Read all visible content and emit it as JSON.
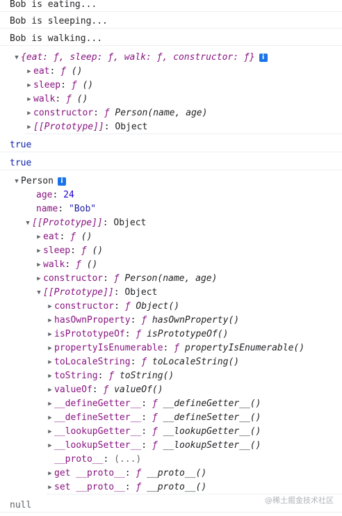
{
  "console": {
    "log1": "Bob is eating...",
    "log2": "Bob is sleeping...",
    "log3": "Bob is walking...",
    "proto_summary": "{eat: ƒ, sleep: ƒ, walk: ƒ, constructor: ƒ}",
    "proto_props": {
      "eat": "eat",
      "sleep": "sleep",
      "walk": "walk",
      "constructor": "constructor",
      "prototype": "[[Prototype]]",
      "fn_empty": "()",
      "fn_person": "Person(name, age)",
      "object": "Object"
    },
    "true1": "true",
    "true2": "true",
    "person": {
      "label": "Person",
      "age_key": "age",
      "age_val": "24",
      "name_key": "name",
      "name_val": "\"Bob\"",
      "prototype": "[[Prototype]]",
      "object": "Object"
    },
    "object_proto": {
      "constructor_val": "Object()",
      "hasOwnProperty": "hasOwnProperty",
      "hasOwnProperty_val": "hasOwnProperty()",
      "isPrototypeOf": "isPrototypeOf",
      "isPrototypeOf_val": "isPrototypeOf()",
      "propertyIsEnumerable": "propertyIsEnumerable",
      "propertyIsEnumerable_val": "propertyIsEnumerable()",
      "toLocaleString": "toLocaleString",
      "toLocaleString_val": "toLocaleString()",
      "toString": "toString",
      "toString_val": "toString()",
      "valueOf": "valueOf",
      "valueOf_val": "valueOf()",
      "defineGetter": "__defineGetter__",
      "defineGetter_val": "__defineGetter__()",
      "defineSetter": "__defineSetter__",
      "defineSetter_val": "__defineSetter__()",
      "lookupGetter": "__lookupGetter__",
      "lookupGetter_val": "__lookupGetter__()",
      "lookupSetter": "__lookupSetter__",
      "lookupSetter_val": "__lookupSetter__()",
      "proto": "__proto__",
      "proto_val": "(...)",
      "get_proto": "get __proto__",
      "get_proto_val": "__proto__()",
      "set_proto": "set __proto__",
      "set_proto_val": "__proto__()"
    },
    "null": "null",
    "f_symbol": "ƒ",
    "info_icon": "i"
  },
  "watermark": "@稀土掘金技术社区"
}
